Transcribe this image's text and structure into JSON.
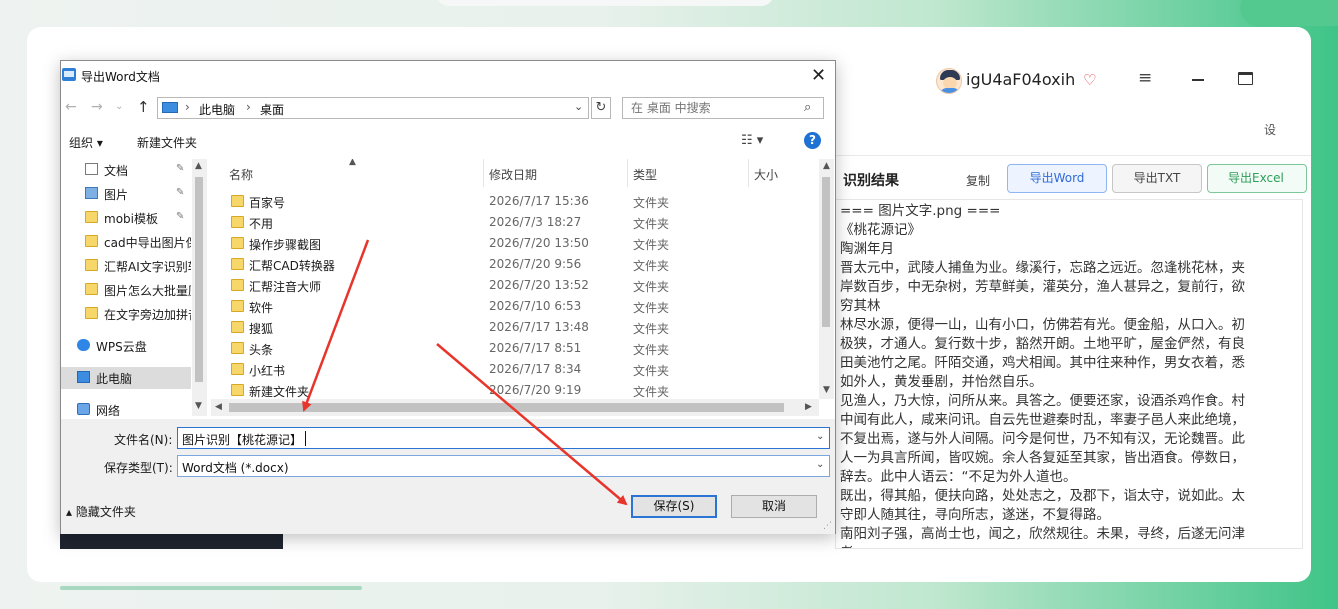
{
  "app": {
    "username": "igU4aF04oxih",
    "settings_label": "设",
    "result_title": "识别结果",
    "copy_label": "复制",
    "export_word": "导出Word",
    "export_txt": "导出TXT",
    "export_excel": "导出Excel",
    "result_lines": [
      "=== 图片文字.png ===",
      "《桃花源记》",
      "陶渊年月",
      "晋太元中，武陵人捕鱼为业。缘溪行，忘路之远近。忽逢桃花林，夹岸数百步，中无杂树，芳草鲜美，灌英分，渔人甚异之，复前行，欲穷其林",
      "林尽水源，便得一山，山有小口，仿佛若有光。便金船，从口入。初极狭，才通人。复行数十步，豁然开朗。土地平旷，屋金俨然，有良田美池竹之尾。阡陌交通，鸡犬相闻。其中往来种作，男女衣着，悉如外人，黄发垂剧，并怡然自乐。",
      "见渔人，乃大惊，问所从来。具答之。便要还家，设酒杀鸡作食。村中闻有此人，咸来问讯。自云先世避秦时乱，率妻子邑人来此绝境，不复出焉，遂与外人间隔。问今是何世，乃不知有汉，无论魏晋。此人一为具言所闻，皆叹婉。余人各复延至其家，皆出酒食。停数日，辞去。此中人语云：“不足为外人道也。",
      "既出，得其船，便扶向路，处处志之，及郡下，诣太守，说如此。太守即人随其往，寻向所志，遂迷，不复得路。",
      "南阳刘子强，高尚士也，闻之，欣然规往。未果，寻终，后遂无问津者。"
    ]
  },
  "dialog": {
    "title": "导出Word文档",
    "breadcrumb": [
      "此电脑",
      "桌面"
    ],
    "search_placeholder": "在 桌面 中搜索",
    "organize_label": "组织 ▾",
    "new_folder_label": "新建文件夹",
    "nav_items": [
      {
        "label": "文档",
        "icon": "document-icon",
        "pinned": true
      },
      {
        "label": "图片",
        "icon": "picture-icon",
        "pinned": true
      },
      {
        "label": "mobi模板",
        "icon": "folder-icon",
        "pinned": true
      },
      {
        "label": "cad中导出图片保",
        "icon": "folder-icon",
        "pinned": false
      },
      {
        "label": "汇帮AI文字识别软",
        "icon": "folder-icon",
        "pinned": false
      },
      {
        "label": "图片怎么大批量压",
        "icon": "folder-icon",
        "pinned": false
      },
      {
        "label": "在文字旁边加拼音",
        "icon": "folder-icon",
        "pinned": false
      },
      {
        "label": "WPS云盘",
        "icon": "cloud-icon",
        "pinned": false
      },
      {
        "label": "此电脑",
        "icon": "computer-icon",
        "pinned": false
      },
      {
        "label": "网络",
        "icon": "network-icon",
        "pinned": false
      }
    ],
    "columns": {
      "name": "名称",
      "date": "修改日期",
      "type": "类型",
      "size": "大小"
    },
    "files": [
      {
        "name": "百家号",
        "date": "2026/7/17 15:36",
        "type": "文件夹"
      },
      {
        "name": "不用",
        "date": "2026/7/3 18:27",
        "type": "文件夹"
      },
      {
        "name": "操作步骤截图",
        "date": "2026/7/20 13:50",
        "type": "文件夹"
      },
      {
        "name": "汇帮CAD转换器",
        "date": "2026/7/20 9:56",
        "type": "文件夹"
      },
      {
        "name": "汇帮注音大师",
        "date": "2026/7/20 13:52",
        "type": "文件夹"
      },
      {
        "name": "软件",
        "date": "2026/7/10 6:53",
        "type": "文件夹"
      },
      {
        "name": "搜狐",
        "date": "2026/7/17 13:48",
        "type": "文件夹"
      },
      {
        "name": "头条",
        "date": "2026/7/17 8:51",
        "type": "文件夹"
      },
      {
        "name": "小红书",
        "date": "2026/7/17 8:34",
        "type": "文件夹"
      },
      {
        "name": "新建文件夹",
        "date": "2026/7/20 9:19",
        "type": "文件夹"
      }
    ],
    "filename_label": "文件名(N):",
    "filename_value": "图片识别【桃花源记】",
    "filetype_label": "保存类型(T):",
    "filetype_value": "Word文档 (*.docx)",
    "hide_folders_label": "隐藏文件夹",
    "save_label": "保存(S)",
    "cancel_label": "取消"
  },
  "colors": {
    "accent": "#2a74d6",
    "arrow": "#e8352b",
    "brand_green": "#3fc487"
  }
}
